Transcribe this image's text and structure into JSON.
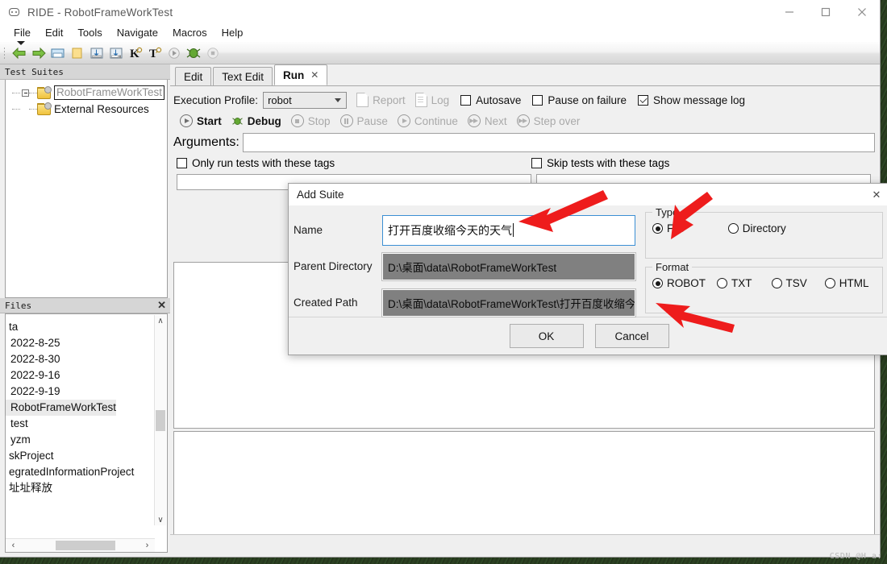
{
  "window": {
    "title": "RIDE - RobotFrameWorkTest",
    "icon": "robot-icon",
    "controls": {
      "minimize": "—",
      "maximize": "□",
      "close": "✕"
    }
  },
  "menubar": {
    "items": [
      "File",
      "Edit",
      "Tools",
      "Navigate",
      "Macros",
      "Help"
    ]
  },
  "toolbar": {
    "items": [
      {
        "name": "back-arrow-icon",
        "glyph": "back"
      },
      {
        "name": "forward-arrow-icon",
        "glyph": "forward"
      },
      {
        "name": "open-folder-icon",
        "glyph": "open"
      },
      {
        "name": "new-folder-icon",
        "glyph": "folder"
      },
      {
        "name": "save-icon",
        "glyph": "save"
      },
      {
        "name": "save-all-icon",
        "glyph": "saveall"
      },
      {
        "name": "search-keyword-icon",
        "glyph": "K"
      },
      {
        "name": "search-test-icon",
        "glyph": "T"
      },
      {
        "name": "run-icon",
        "glyph": "run"
      },
      {
        "name": "debug-icon",
        "glyph": "debug"
      },
      {
        "name": "stop-icon",
        "glyph": "stop"
      }
    ]
  },
  "sidebar": {
    "tree_panel_title": "Test Suites",
    "tree": [
      {
        "label": "RobotFrameWorkTest",
        "selected": true,
        "expander": true
      },
      {
        "label": "External Resources",
        "selected": false,
        "expander": false
      }
    ],
    "files_panel_title": "Files",
    "files_close": "✕",
    "files": [
      {
        "label": "ta",
        "selected": false
      },
      {
        "label": "2022-8-25",
        "selected": false
      },
      {
        "label": "2022-8-30",
        "selected": false
      },
      {
        "label": "2022-9-16",
        "selected": false
      },
      {
        "label": "2022-9-19",
        "selected": false
      },
      {
        "label": "RobotFrameWorkTest",
        "selected": true
      },
      {
        "label": "test",
        "selected": false
      },
      {
        "label": "yzm",
        "selected": false
      },
      {
        "label": "skProject",
        "selected": false
      },
      {
        "label": "egratedInformationProject",
        "selected": false
      },
      {
        "label": "址址释放",
        "selected": false
      }
    ],
    "scroll": {
      "up": "∧",
      "down": "∨",
      "left": "‹",
      "right": "›"
    }
  },
  "tabs": [
    {
      "label": "Edit",
      "active": false,
      "closable": false
    },
    {
      "label": "Text Edit",
      "active": false,
      "closable": false
    },
    {
      "label": "Run",
      "active": true,
      "closable": true,
      "close_glyph": "✕"
    }
  ],
  "run_pane": {
    "execution_profile_label": "Execution Profile:",
    "execution_profile_value": "robot",
    "report_label": "Report",
    "log_label": "Log",
    "autosave_label": "Autosave",
    "autosave_checked": false,
    "pause_on_failure_label": "Pause on failure",
    "pause_on_failure_checked": false,
    "show_message_log_label": "Show message log",
    "show_message_log_checked": true,
    "actions": [
      {
        "label": "Start",
        "enabled": true
      },
      {
        "label": "Debug",
        "enabled": true
      },
      {
        "label": "Stop",
        "enabled": false
      },
      {
        "label": "Pause",
        "enabled": false
      },
      {
        "label": "Continue",
        "enabled": false
      },
      {
        "label": "Next",
        "enabled": false
      },
      {
        "label": "Step over",
        "enabled": false
      }
    ],
    "arguments_label": "Arguments:",
    "arguments_value": "",
    "only_run_tags_label": "Only run tests with these tags",
    "only_run_tags_checked": false,
    "skip_tags_label": "Skip tests with these tags",
    "skip_tags_checked": false
  },
  "dialog": {
    "title": "Add Suite",
    "close_glyph": "✕",
    "name_label": "Name",
    "name_value": "打开百度收缩今天的天气",
    "parent_directory_label": "Parent Directory",
    "parent_directory_value": "D:\\桌面\\data\\RobotFrameWorkTest",
    "created_path_label": "Created Path",
    "created_path_value": "D:\\桌面\\data\\RobotFrameWorkTest\\打开百度收缩今",
    "type_group_label": "Type",
    "type_options": [
      {
        "label": "File",
        "selected": true
      },
      {
        "label": "Directory",
        "selected": false
      }
    ],
    "format_group_label": "Format",
    "format_options": [
      {
        "label": "ROBOT",
        "selected": true
      },
      {
        "label": "TXT",
        "selected": false
      },
      {
        "label": "TSV",
        "selected": false
      },
      {
        "label": "HTML",
        "selected": false
      }
    ],
    "ok_label": "OK",
    "cancel_label": "Cancel"
  },
  "annotations": {
    "arrow_color": "#ee1c1c",
    "arrows": [
      {
        "name": "arrow-to-name-field"
      },
      {
        "name": "arrow-to-type-file-radio"
      },
      {
        "name": "arrow-to-format-robot-radio"
      }
    ]
  },
  "watermark": {
    "text": "CSDN @H a:"
  }
}
